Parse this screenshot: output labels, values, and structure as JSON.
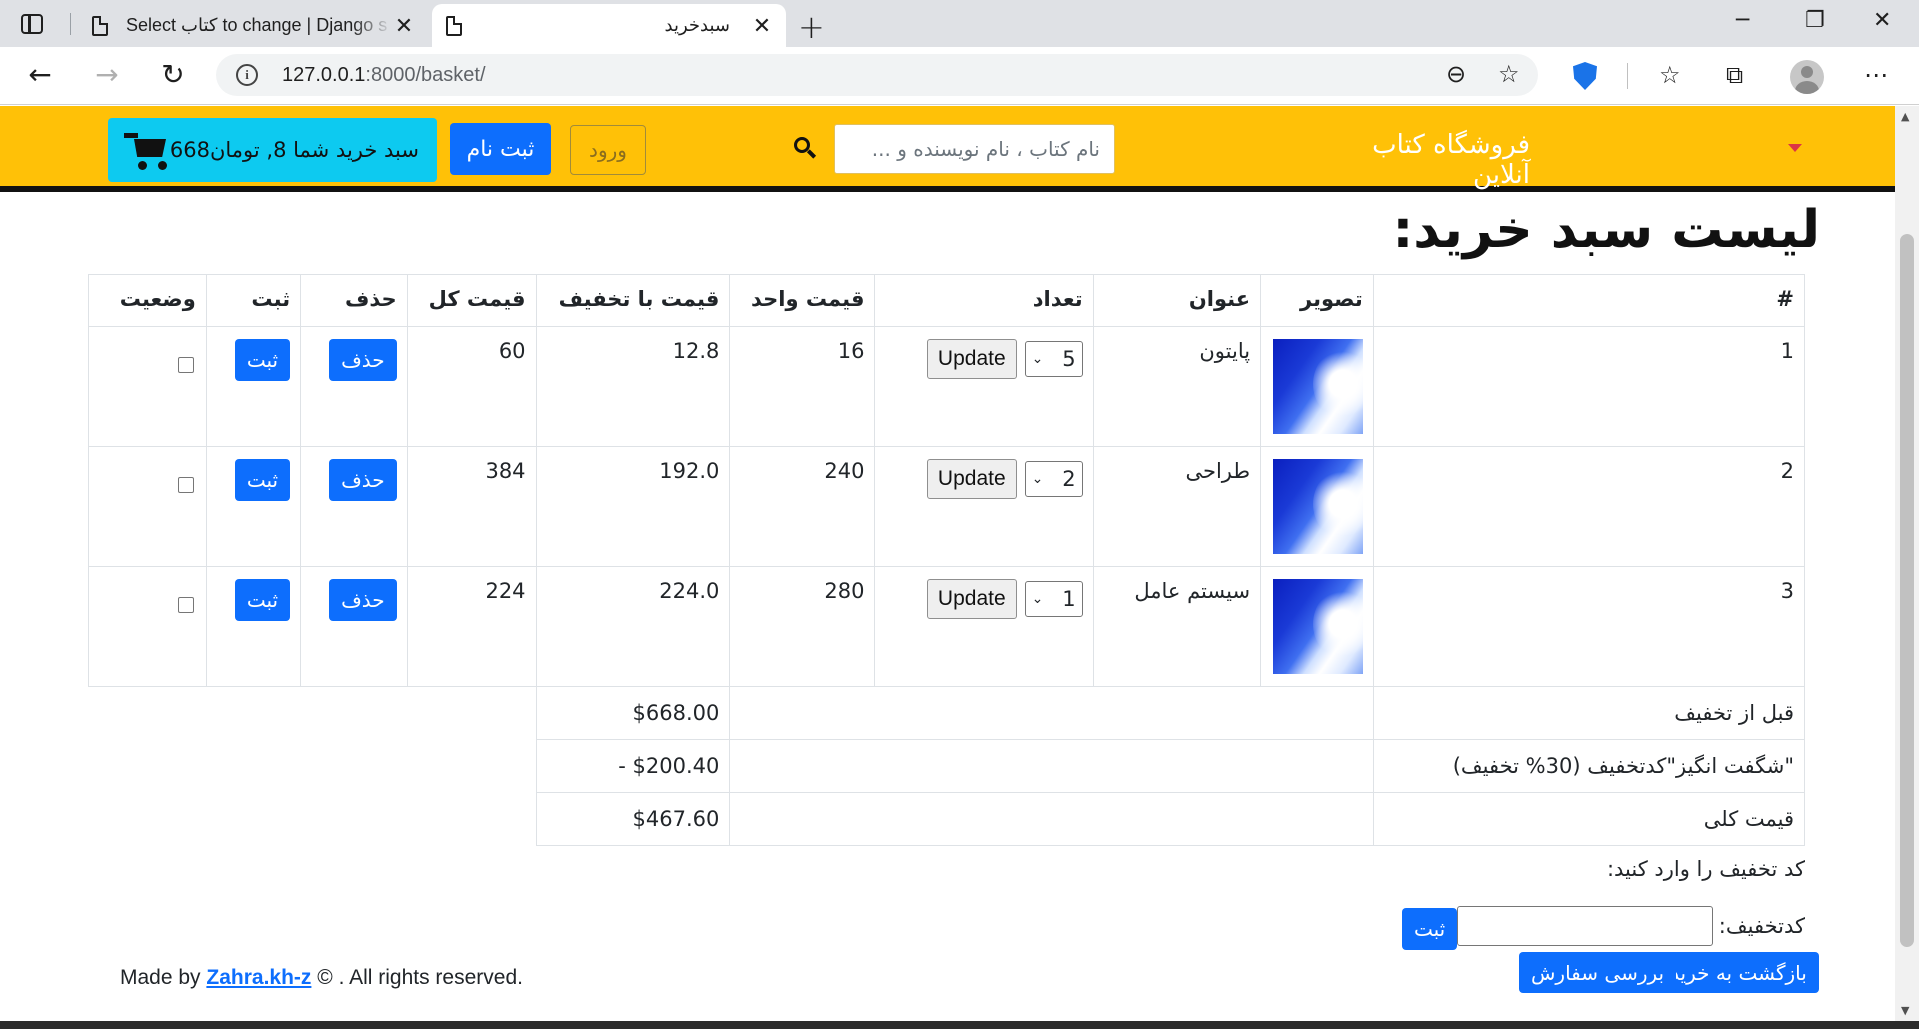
{
  "browser": {
    "tabs": [
      {
        "title": "Select کتاب to change | Django s",
        "active": false
      },
      {
        "title": "سبدخرید",
        "active": true
      }
    ],
    "url_host": "127.0.0.1",
    "url_path": ":8000/basket/"
  },
  "navbar": {
    "brand": "فروشگاه کتاب آنلاین",
    "search_placeholder": "نام کتاب ، نام نویسنده و ...",
    "login_label": "ورود",
    "register_label": "ثبت نام",
    "basket_label": "سبد خرید شما 8, تومان668",
    "colors": {
      "navbar_bg": "#ffc107",
      "primary": "#0d6efd",
      "info": "#0dcaf0"
    }
  },
  "page": {
    "title": "لیست سبد خرید:"
  },
  "table": {
    "headers": [
      "#",
      "تصویر",
      "عنوان",
      "تعداد",
      "قیمت واحد",
      "قیمت با تخفیف",
      "قیمت کل",
      "حذف",
      "ثبت",
      "وضعیت"
    ],
    "rows": [
      {
        "index": "1",
        "title": "پایتون",
        "qty": "5",
        "unit_price": "16",
        "discounted_price": "12.8",
        "total": "60",
        "update_label": "Update",
        "delete_label": "حذف",
        "submit_label": "ثبت",
        "checked": false
      },
      {
        "index": "2",
        "title": "طراحی",
        "qty": "2",
        "unit_price": "240",
        "discounted_price": "192.0",
        "total": "384",
        "update_label": "Update",
        "delete_label": "حذف",
        "submit_label": "ثبت",
        "checked": false
      },
      {
        "index": "3",
        "title": "سیستم عامل",
        "qty": "1",
        "unit_price": "280",
        "discounted_price": "224.0",
        "total": "224",
        "update_label": "Update",
        "delete_label": "حذف",
        "submit_label": "ثبت",
        "checked": false
      }
    ],
    "summary": [
      {
        "label": "قبل از تخفیف",
        "value": "$668.00"
      },
      {
        "label": "\"شگفت انگیز\"کدتخفیف (30% تخفیف)",
        "value": "- $200.40"
      },
      {
        "label": "قیمت کلی",
        "value": "$467.60"
      }
    ]
  },
  "coupon": {
    "prompt": "کد تخفیف را وارد کنید:",
    "field_label": "کدتخفیف:",
    "value": "",
    "submit_label": "ثبت"
  },
  "actions": {
    "back_label": "بازگشت به خرید",
    "review_label": "بررسی سفارش"
  },
  "footer": {
    "prefix": "Made by ",
    "author": "Zahra.kh-z",
    "suffix": " © . All rights reserved."
  }
}
